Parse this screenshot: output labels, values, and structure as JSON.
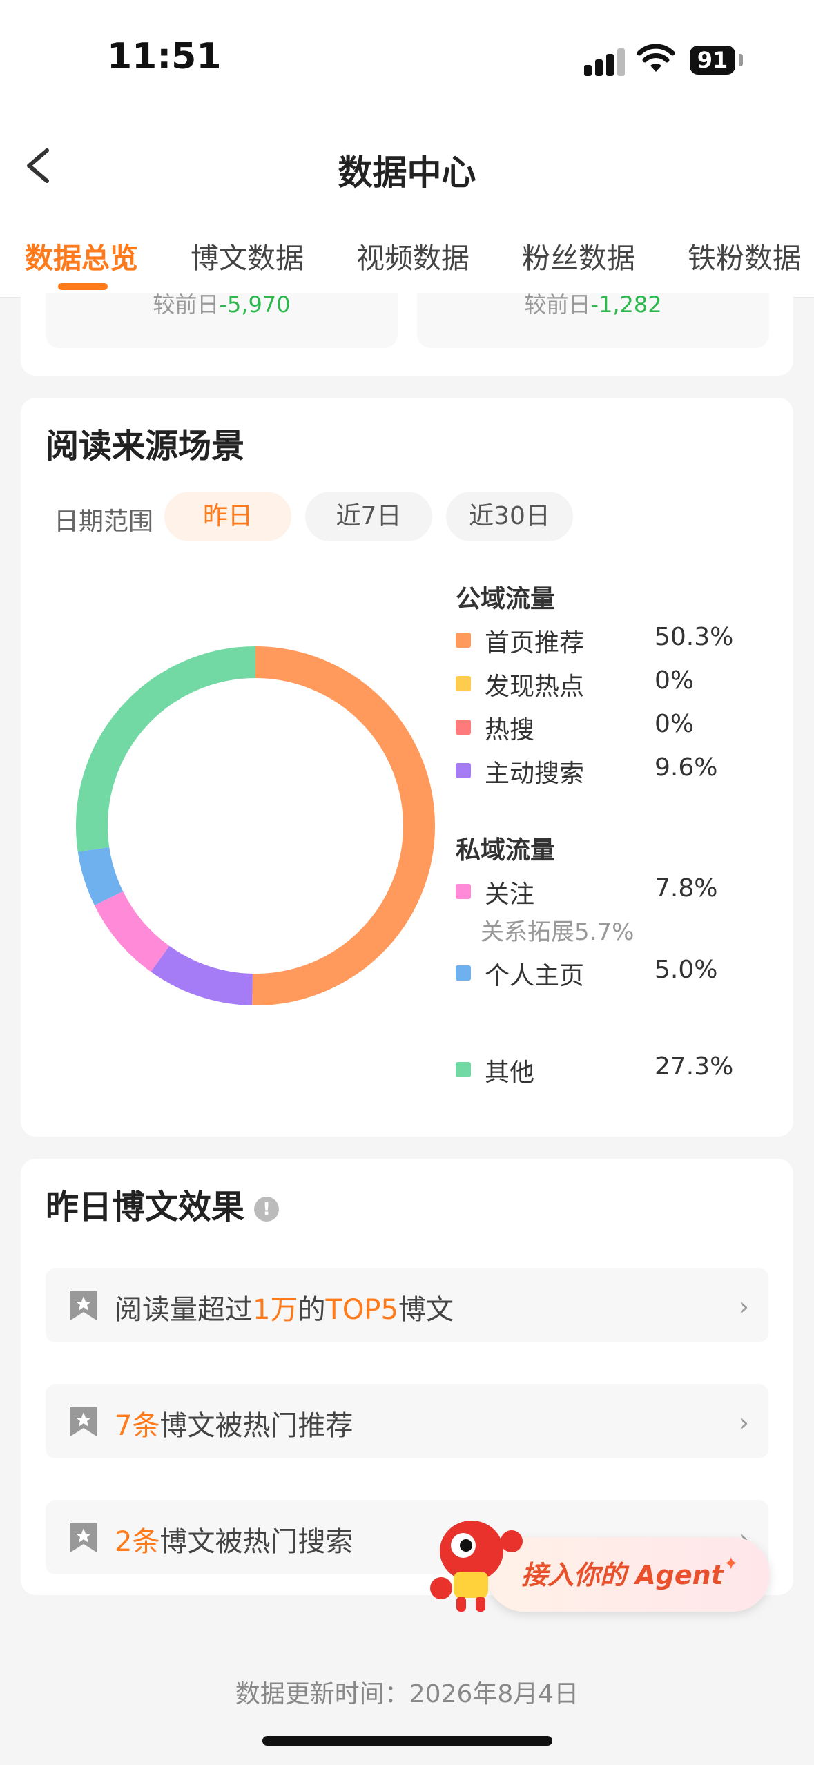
{
  "status_bar": {
    "time": "11:51",
    "battery": "91"
  },
  "header": {
    "title": "数据中心"
  },
  "tabs": [
    "数据总览",
    "博文数据",
    "视频数据",
    "粉丝数据",
    "铁粉数据"
  ],
  "top_cards": [
    {
      "prefix": "较前日",
      "delta": "-5,970"
    },
    {
      "prefix": "较前日",
      "delta": "-1,282"
    }
  ],
  "read_source": {
    "title": "阅读来源场景",
    "date_label": "日期范围",
    "date_options": [
      "昨日",
      "近7日",
      "近30日"
    ],
    "selected_date": "昨日",
    "public_heading": "公域流量",
    "private_heading": "私域流量",
    "items": [
      {
        "name": "首页推荐",
        "pct": "50.3%",
        "color": "#ff9a5c",
        "value": 50.3
      },
      {
        "name": "发现热点",
        "pct": "0%",
        "color": "#ffcc4d",
        "value": 0
      },
      {
        "name": "热搜",
        "pct": "0%",
        "color": "#ff7b7b",
        "value": 0
      },
      {
        "name": "主动搜索",
        "pct": "9.6%",
        "color": "#a57cf5",
        "value": 9.6
      },
      {
        "name": "关注",
        "pct": "7.8%",
        "color": "#ff8ad8",
        "value": 7.8
      },
      {
        "name": "个人主页",
        "pct": "5.0%",
        "color": "#6eb1ee",
        "value": 5.0
      },
      {
        "name": "其他",
        "pct": "27.3%",
        "color": "#72d9a4",
        "value": 27.3
      }
    ],
    "follow_sub": "关系拓展5.7%"
  },
  "yesterday": {
    "title": "昨日博文效果",
    "rows": [
      {
        "a": "阅读量超过",
        "b": "1万",
        "c": "的",
        "d": "TOP5",
        "e": "博文"
      },
      {
        "a": "",
        "b": "7条",
        "c": "博文被热门推荐",
        "d": "",
        "e": ""
      },
      {
        "a": "",
        "b": "2条",
        "c": "博文被热门搜索",
        "d": "",
        "e": ""
      }
    ],
    "chevron": "›"
  },
  "agent": {
    "label": "接入你的 Agent",
    "sparkle": "✦"
  },
  "footer": {
    "update_time": "数据更新时间：2026年8月4日"
  }
}
